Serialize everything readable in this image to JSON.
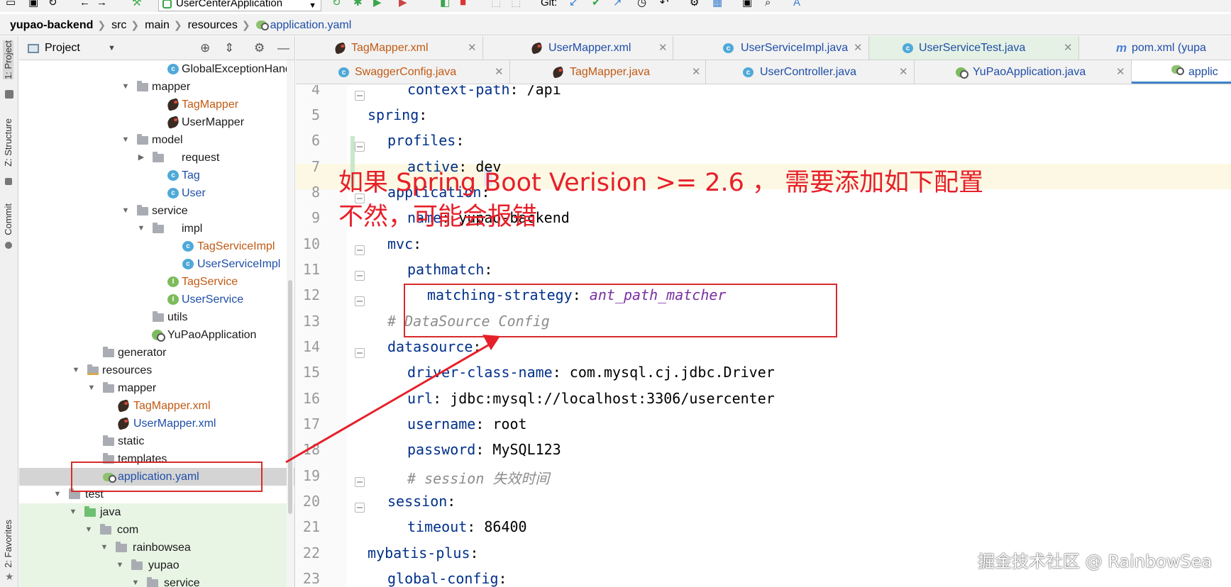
{
  "toolbar": {
    "run_config": "UserCenterApplication",
    "git_label": "Git:"
  },
  "breadcrumb": [
    "yupao-backend",
    "src",
    "main",
    "resources",
    "application.yaml"
  ],
  "left_strip": {
    "project": "1: Project",
    "structure": "Z: Structure",
    "commit": "Commit",
    "favorites": "2: Favorites"
  },
  "panel": {
    "title": "Project"
  },
  "tree": [
    {
      "label": "GlobalExceptionHandl",
      "icon": "class-icon"
    },
    {
      "label": "mapper",
      "icon": "folder-icon"
    },
    {
      "label": "TagMapper",
      "icon": "mybatis-icon"
    },
    {
      "label": "UserMapper",
      "icon": "mybatis-icon"
    },
    {
      "label": "model",
      "icon": "folder-icon"
    },
    {
      "label": "request",
      "icon": "folder-icon"
    },
    {
      "label": "Tag",
      "icon": "class-icon"
    },
    {
      "label": "User",
      "icon": "class-icon"
    },
    {
      "label": "service",
      "icon": "folder-icon"
    },
    {
      "label": "impl",
      "icon": "folder-icon"
    },
    {
      "label": "TagServiceImpl",
      "icon": "class-icon"
    },
    {
      "label": "UserServiceImpl",
      "icon": "class-icon"
    },
    {
      "label": "TagService",
      "icon": "interface-icon"
    },
    {
      "label": "UserService",
      "icon": "interface-icon"
    },
    {
      "label": "utils",
      "icon": "folder-icon"
    },
    {
      "label": "YuPaoApplication",
      "icon": "spring-icon"
    },
    {
      "label": "generator",
      "icon": "folder-icon"
    },
    {
      "label": "resources",
      "icon": "resources-folder-icon"
    },
    {
      "label": "mapper",
      "icon": "folder-icon"
    },
    {
      "label": "TagMapper.xml",
      "icon": "mybatis-icon"
    },
    {
      "label": "UserMapper.xml",
      "icon": "mybatis-icon"
    },
    {
      "label": "static",
      "icon": "folder-icon"
    },
    {
      "label": "templates",
      "icon": "folder-icon"
    },
    {
      "label": "application.yaml",
      "icon": "yaml-icon"
    },
    {
      "label": "test",
      "icon": "folder-icon"
    },
    {
      "label": "java",
      "icon": "folder-icon"
    },
    {
      "label": "com",
      "icon": "folder-icon"
    },
    {
      "label": "rainbowsea",
      "icon": "folder-icon"
    },
    {
      "label": "yupao",
      "icon": "folder-icon"
    },
    {
      "label": "service",
      "icon": "folder-icon"
    }
  ],
  "tabs_row1": [
    "TagMapper.xml",
    "UserMapper.xml",
    "UserServiceImpl.java",
    "UserServiceTest.java",
    "pom.xml (yupa"
  ],
  "tabs_row2": [
    "SwaggerConfig.java",
    "TagMapper.java",
    "UserController.java",
    "YuPaoApplication.java",
    "applic"
  ],
  "code": {
    "line_numbers": [
      "4",
      "5",
      "6",
      "7",
      "8",
      "9",
      "10",
      "11",
      "12",
      "13",
      "14",
      "15",
      "16",
      "17",
      "18",
      "19",
      "20",
      "21",
      "22",
      "23"
    ],
    "lines": [
      {
        "key": "context-path",
        "value": " /api"
      },
      {
        "key": "spring",
        "value": ""
      },
      {
        "key": "profiles",
        "value": ""
      },
      {
        "key": "active",
        "value": " dev"
      },
      {
        "key": "application",
        "value": ""
      },
      {
        "key": "name",
        "value": " yupao-backend"
      },
      {
        "key": "mvc",
        "value": ""
      },
      {
        "key": "pathmatch",
        "value": ""
      },
      {
        "key": "matching-strategy",
        "value": " ant_path_matcher"
      },
      {
        "comment": "# DataSource Config"
      },
      {
        "key": "datasource",
        "value": ""
      },
      {
        "key": "driver-class-name",
        "value": " com.mysql.cj.jdbc.Driver"
      },
      {
        "key": "url",
        "value": " jdbc:mysql://localhost:3306/usercenter"
      },
      {
        "key": "username",
        "value": " root"
      },
      {
        "key": "password",
        "value": " MySQL123"
      },
      {
        "comment": "# session 失效时间"
      },
      {
        "key": "session",
        "value": ""
      },
      {
        "key": "timeout",
        "value": " 86400"
      },
      {
        "key": "mybatis-plus",
        "value": ""
      },
      {
        "key": "global-config",
        "value": ""
      }
    ]
  },
  "annotation": {
    "line1": "如果 Spring Boot Verision  >= 2.6 ， 需要添加如下配置",
    "line2": "不然，可能会报错"
  },
  "watermark": "掘金技术社区 @ RainbowSea",
  "colors": {
    "annotation_red": "#e6202a",
    "key_blue": "#00308a",
    "string_purple": "#7a2fa0",
    "tab_active_border": "#4083c9"
  }
}
